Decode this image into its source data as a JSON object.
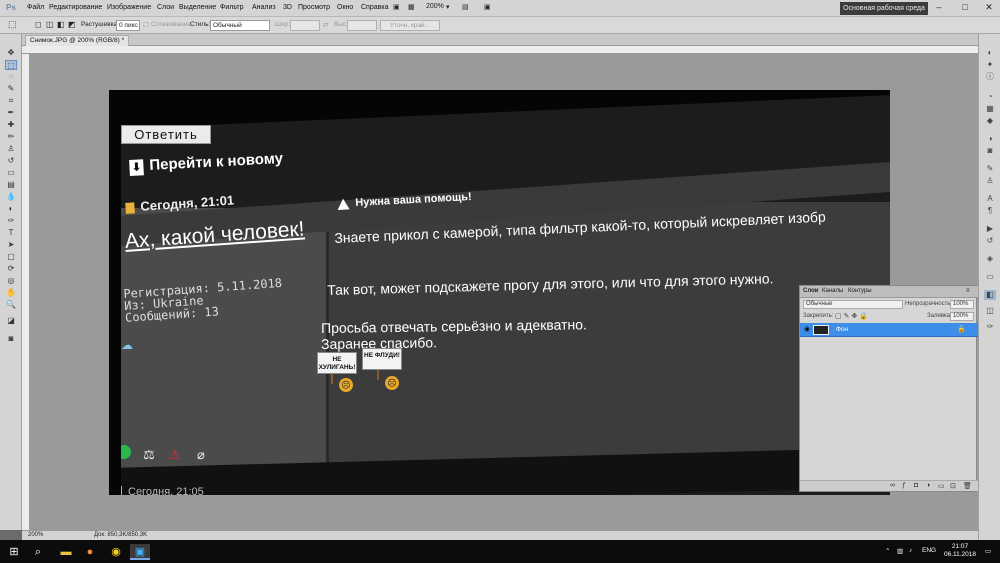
{
  "app": {
    "logo": "Ps",
    "menu": [
      "Файл",
      "Редактирование",
      "Изображение",
      "Слои",
      "Выделение",
      "Фильтр",
      "Анализ",
      "3D",
      "Просмотр",
      "Окно",
      "Справка"
    ],
    "zoom_menu": "200%",
    "workspace_button": "Основная рабочая среда",
    "window_controls": [
      "–",
      "□",
      "✕"
    ]
  },
  "options": {
    "feather_label": "Растушевка:",
    "feather_value": "0 пикс",
    "antialias_label": "Сглаживание",
    "style_label": "Стиль:",
    "style_value": "Обычный",
    "width_label": "Шир:",
    "height_label": "Выс:",
    "refine_button": "Уточн. край..."
  },
  "document": {
    "tab_title": "Снимок.JPG @ 200% (RGB/8) *",
    "status_zoom": "200%",
    "status_doc": "Док: 850,3K/850,3K"
  },
  "image": {
    "reply_button": "Ответить",
    "goto_new": "Перейти к новому",
    "post_date": "Сегодня, 21:01",
    "username": "Ах, какой человек!",
    "registration": "Регистрация: 5.11.2018",
    "from": "Из: Ukraine",
    "messages": "Сообщений: 13",
    "post_title": "Нужна ваша помощь!",
    "line1": "Знаете прикол с камерой, типа фильтр какой-то, который искревляет изобр",
    "line2": "Так вот, может подскажете прогу для этого, или что для этого нужно.",
    "line3": "Просьба отвечать серьёзно и адекватно.",
    "line4": "Заранее спасибо.",
    "sign1": "НЕ ХУЛИГАНЬ!",
    "sign2": "НЕ ФЛУДИ!",
    "next_date": "Сегодня, 21:05"
  },
  "layers_panel": {
    "tabs": [
      "Слои",
      "Каналы",
      "Контуры"
    ],
    "blend_mode": "Обычные",
    "opacity_label": "Непрозрачность:",
    "opacity_value": "100%",
    "lock_label": "Закрепить:",
    "fill_label": "Заливка:",
    "fill_value": "100%",
    "layer_name": "Фон"
  },
  "taskbar": {
    "lang": "ENG",
    "time": "21:07",
    "date": "06.11.2018"
  },
  "colors": {
    "accent_blue": "#3d8ee8",
    "taskbar": "#0c0c0c",
    "ps_gray": "#d4d4d4"
  }
}
